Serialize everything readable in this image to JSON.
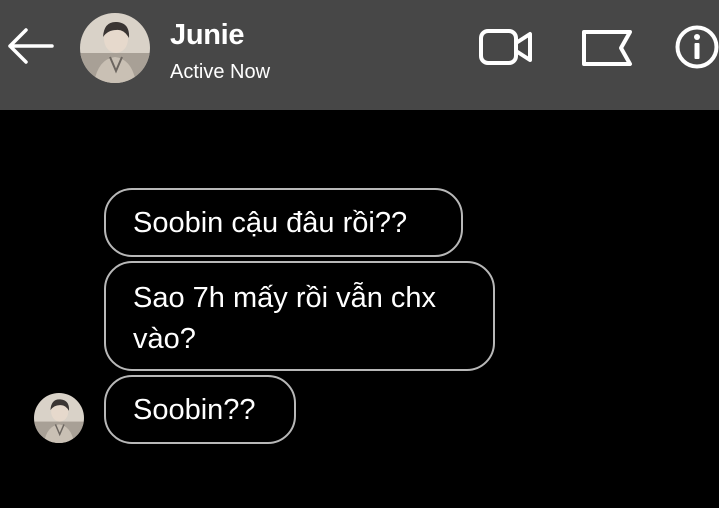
{
  "header": {
    "contact_name": "Junie",
    "status_text": "Active Now",
    "icons": [
      "back-arrow-icon",
      "video-call-icon",
      "flag-icon",
      "info-icon"
    ],
    "background": "#474747"
  },
  "messages": [
    {
      "text_lines": [
        "Soobin cậu đâu rồi??"
      ]
    },
    {
      "text_lines": [
        "Sao 7h mấy rồi vẫn chx",
        "vào?"
      ]
    },
    {
      "text_lines": [
        "Soobin??"
      ]
    }
  ],
  "colors": {
    "background": "#000000",
    "bubble_border": "#b8b8b8",
    "text": "#ffffff"
  }
}
